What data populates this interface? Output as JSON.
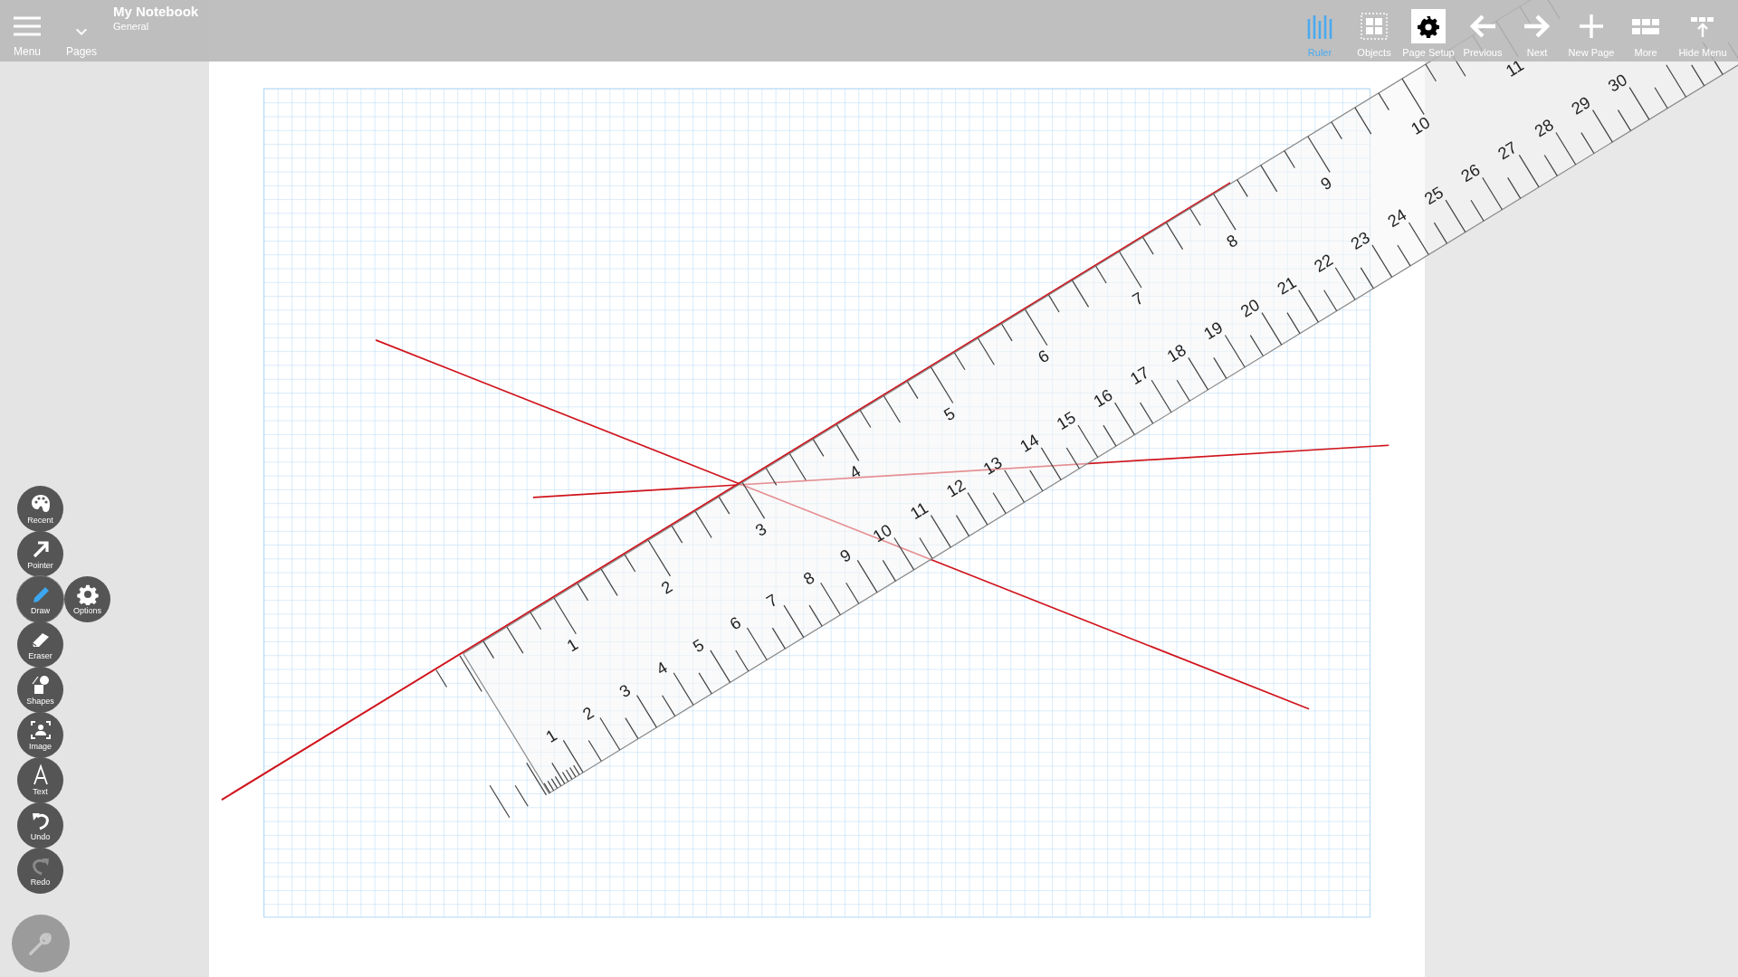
{
  "header": {
    "menu_label": "Menu",
    "pages_label": "Pages",
    "notebook_title": "My Notebook",
    "section": "General"
  },
  "toolbar": [
    {
      "kind": "ruler",
      "label": "Ruler",
      "selected": true,
      "highlighted": false
    },
    {
      "kind": "objects",
      "label": "Objects",
      "selected": false,
      "highlighted": false
    },
    {
      "kind": "page_setup",
      "label": "Page Setup",
      "selected": false,
      "highlighted": true
    },
    {
      "kind": "previous",
      "label": "Previous",
      "selected": false,
      "highlighted": false
    },
    {
      "kind": "next",
      "label": "Next",
      "selected": false,
      "highlighted": false
    },
    {
      "kind": "new_page",
      "label": "New Page",
      "selected": false,
      "highlighted": false
    },
    {
      "kind": "more",
      "label": "More",
      "selected": false,
      "highlighted": false
    },
    {
      "kind": "hide_menu",
      "label": "Hide Menu",
      "selected": false,
      "highlighted": false
    }
  ],
  "tools": [
    {
      "kind": "recent",
      "label": "Recent",
      "selected": false,
      "disabled": false
    },
    {
      "kind": "pointer",
      "label": "Pointer",
      "selected": false,
      "disabled": false
    },
    {
      "kind": "draw",
      "label": "Draw",
      "selected": true,
      "disabled": false
    },
    {
      "kind": "eraser",
      "label": "Eraser",
      "selected": false,
      "disabled": false
    },
    {
      "kind": "shapes",
      "label": "Shapes",
      "selected": false,
      "disabled": false
    },
    {
      "kind": "image",
      "label": "Image",
      "selected": false,
      "disabled": false
    },
    {
      "kind": "text",
      "label": "Text",
      "selected": false,
      "disabled": false
    },
    {
      "kind": "undo",
      "label": "Undo",
      "selected": false,
      "disabled": false
    },
    {
      "kind": "redo",
      "label": "Redo",
      "selected": false,
      "disabled": true
    }
  ],
  "options": {
    "label": "Options"
  },
  "ruler": {
    "inch_labels": [
      "1",
      "2",
      "3",
      "4",
      "5",
      "6",
      "7",
      "8",
      "9",
      "10",
      "11"
    ],
    "cm_labels": [
      "1",
      "2",
      "3",
      "4",
      "5",
      "6",
      "7",
      "8",
      "9",
      "10",
      "11",
      "12",
      "13",
      "14",
      "15",
      "16",
      "17",
      "18",
      "19",
      "20",
      "21",
      "22",
      "23",
      "24",
      "25",
      "26",
      "27",
      "28",
      "29",
      "30"
    ]
  }
}
